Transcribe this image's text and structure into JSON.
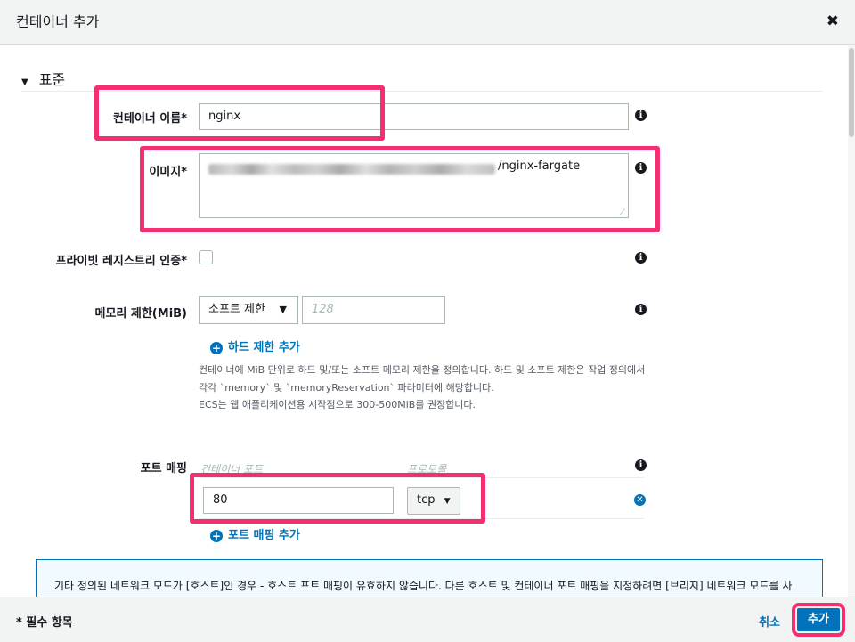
{
  "dialog": {
    "title": "컨테이너 추가",
    "close_glyph": "✖"
  },
  "section": {
    "title": "표준"
  },
  "fields": {
    "container_name": {
      "label": "컨테이너 이름*",
      "value": "nginx"
    },
    "image": {
      "label": "이미지*",
      "value_suffix": "/nginx-fargate"
    },
    "private_registry": {
      "label": "프라이빗 레지스트리 인증*"
    },
    "memory_limit": {
      "label": "메모리 제한(MiB)",
      "select_value": "소프트 제한",
      "input_placeholder": "128",
      "add_hard_limit_link": "하드 제한 추가",
      "help_lines": [
        "컨테이너에 MiB 단위로 하드 및/또는 소프트 메모리 제한을 정의합니다. 하드 및 소프트 제한은 작업 정의에서",
        "각각 `memory` 및 `memoryReservation` 파라미터에 해당합니다.",
        "ECS는 웹 애플리케이션용 시작점으로 300-500MiB를 권장합니다."
      ]
    },
    "port_mapping": {
      "label": "포트 매핑",
      "col_container_port": "컨테이너 포트",
      "col_protocol": "프로토콜",
      "port_value": "80",
      "protocol_value": "tcp",
      "add_link": "포트 매핑 추가"
    }
  },
  "banner": {
    "text": "기타 정의된 네트워크 모드가 [호스트]인 경우 - 호스트 포트 매핑이 유효하지 않습니다. 다른 호스트 및 컨테이너 포트 매핑을 지정하려면 [브리지] 네트워크 모드를 사"
  },
  "footer": {
    "required_note": "* 필수 항목",
    "cancel_label": "취소",
    "add_label": "추가"
  },
  "colors": {
    "accent": "#0073bb",
    "highlight": "#f52e72"
  },
  "icons": {
    "info": "info-icon",
    "close": "close-icon",
    "plus": "plus-circle-icon",
    "remove": "remove-circle-icon",
    "caret": "caret-down-icon"
  }
}
